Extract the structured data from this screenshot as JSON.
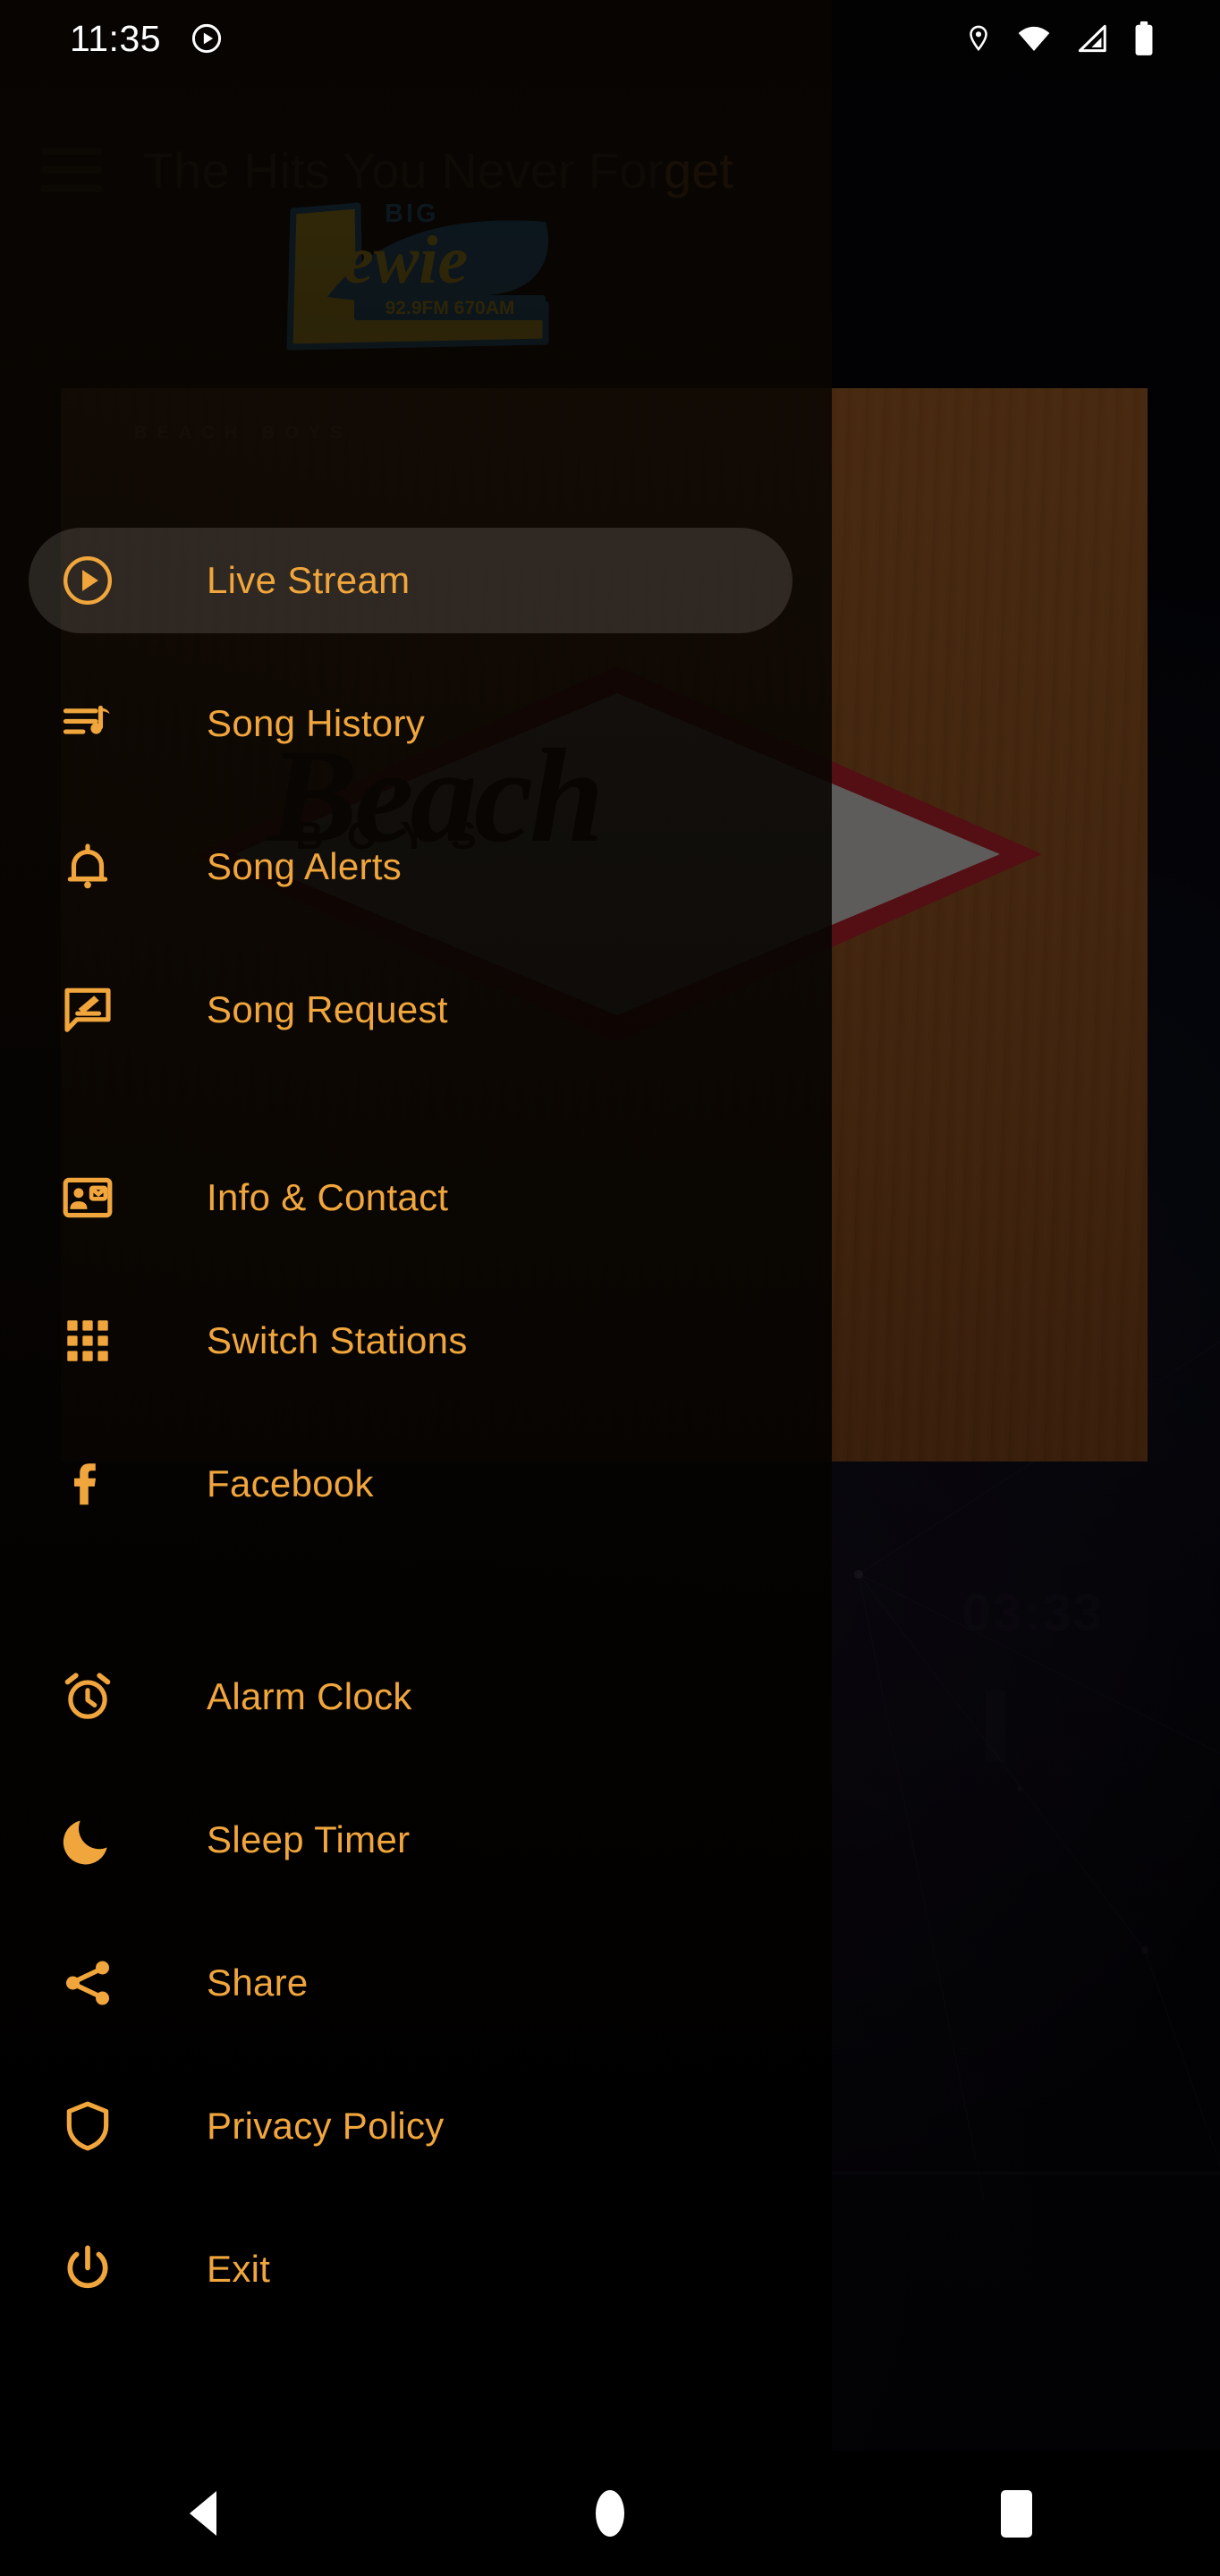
{
  "status_bar": {
    "time": "11:35",
    "left_icons": [
      "play-circle-icon"
    ],
    "right_icons": [
      "location-pin-icon",
      "wifi-icon",
      "cellular-signal-icon",
      "battery-icon"
    ]
  },
  "app_bar": {
    "menu_icon": "hamburger-menu-icon",
    "title": "The Hits You Never For",
    "title_tail": "get",
    "title_full": "The Hits You Never Forget"
  },
  "logo": {
    "big_text": "BIG",
    "name_text": "Lewie",
    "frequency_text": "92.9FM 670AM",
    "yellow": "#F6D22B",
    "blue": "#1B6FA8"
  },
  "background": {
    "album_artist": "BEACH BOYS",
    "album_word": "Beach",
    "album_sub": "BOYS",
    "clock": "03:33"
  },
  "drawer": {
    "accent_color": "#F0A63C",
    "selected_index": 0,
    "items": [
      {
        "label": "Live Stream",
        "icon": "play-circle-icon",
        "selected": true,
        "gap": ""
      },
      {
        "label": "Song History",
        "icon": "queue-music-icon",
        "selected": false,
        "gap": ""
      },
      {
        "label": "Song Alerts",
        "icon": "bell-icon",
        "selected": false,
        "gap": ""
      },
      {
        "label": "Song Request",
        "icon": "chat-edit-icon",
        "selected": false,
        "gap": "gap-lg"
      },
      {
        "label": "Info & Contact",
        "icon": "contact-card-icon",
        "selected": false,
        "gap": ""
      },
      {
        "label": "Switch Stations",
        "icon": "grid-apps-icon",
        "selected": false,
        "gap": ""
      },
      {
        "label": "Facebook",
        "icon": "facebook-icon",
        "selected": false,
        "gap": "gap-xl"
      },
      {
        "label": "Alarm Clock",
        "icon": "alarm-clock-icon",
        "selected": false,
        "gap": ""
      },
      {
        "label": "Sleep Timer",
        "icon": "moon-icon",
        "selected": false,
        "gap": ""
      },
      {
        "label": "Share",
        "icon": "share-nodes-icon",
        "selected": false,
        "gap": ""
      },
      {
        "label": "Privacy Policy",
        "icon": "shield-icon",
        "selected": false,
        "gap": ""
      },
      {
        "label": "Exit",
        "icon": "power-icon",
        "selected": false,
        "gap": ""
      }
    ]
  },
  "nav_bar": {
    "back": "back-button",
    "home": "home-button",
    "recents": "recents-button"
  }
}
